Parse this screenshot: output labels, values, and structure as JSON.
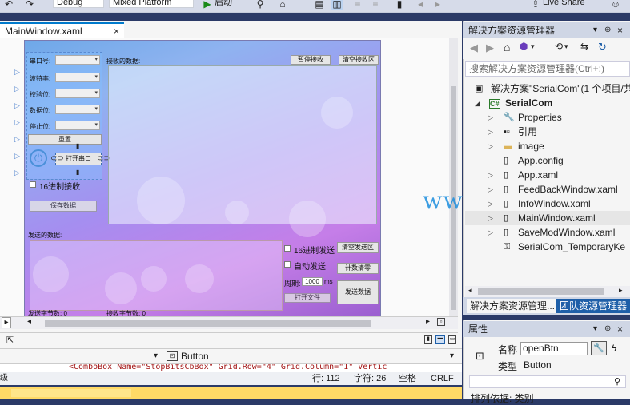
{
  "toolbar": {
    "config_combo": "Debug",
    "platform_combo": "Mixed Platform",
    "start_label": "启动",
    "live_share": "Live Share"
  },
  "editor": {
    "doc_tab": "MainWindow.xaml",
    "doc_tab_close": "×",
    "zoom_badge": "60",
    "col_badge": "1*"
  },
  "app": {
    "labels": [
      "串口号:",
      "波特率:",
      "校验位:",
      "数据位:",
      "停止位:"
    ],
    "reset_btn": "重置",
    "open_port_btn": "打开串口",
    "hex_recv_label": "16进制接收",
    "save_data_btn": "保存数据",
    "recv_data_label": "接收的数据:",
    "pause_recv_btn": "暂停接收",
    "clear_recv_btn": "清空接收区",
    "send_data_label": "发送的数据:",
    "hex_send_label": "16进制发送",
    "clear_send_btn": "清空发送区",
    "auto_send_label": "自动发送",
    "count_clear_btn": "计数清零",
    "period_label": "周期:",
    "period_value": "1000",
    "period_unit": "ms",
    "open_file_btn": "打开文件",
    "send_btn": "发送数据",
    "send_bytes_label": "发送字节数: 0",
    "recv_bytes_label": "接收字节数: 0"
  },
  "nav": {
    "member_combo": "Button"
  },
  "code": {
    "line_text": "<ComboBox Name=\"StopBitsCbBox\"   Grid.Row=\"4\"  Grid.Column=\"1\"  Vertic"
  },
  "status": {
    "line": "行: 112",
    "char": "字符: 26",
    "space": "空格",
    "eol": "CRLF"
  },
  "solution": {
    "title": "解决方案资源管理器",
    "search_placeholder": "搜索解决方案资源管理器(Ctrl+;)",
    "items": [
      {
        "label": "解决方案\"SerialCom\"(1 个项目/共",
        "icon": "solution-icon"
      },
      {
        "label": "SerialCom",
        "icon": "csharp-project-icon"
      },
      {
        "label": "Properties",
        "icon": "wrench-icon"
      },
      {
        "label": "引用",
        "icon": "references-icon"
      },
      {
        "label": "image",
        "icon": "folder-icon"
      },
      {
        "label": "App.config",
        "icon": "config-file-icon"
      },
      {
        "label": "App.xaml",
        "icon": "xaml-file-icon"
      },
      {
        "label": "FeedBackWindow.xaml",
        "icon": "xaml-file-icon"
      },
      {
        "label": "InfoWindow.xaml",
        "icon": "xaml-file-icon"
      },
      {
        "label": "MainWindow.xaml",
        "icon": "xaml-file-icon"
      },
      {
        "label": "SaveModWindow.xaml",
        "icon": "xaml-file-icon"
      },
      {
        "label": "SerialCom_TemporaryKe",
        "icon": "key-file-icon"
      }
    ],
    "tab_solution": "解决方案资源管理...",
    "tab_team": "团队资源管理器"
  },
  "properties": {
    "title": "属性",
    "name_label": "名称",
    "name_value": "openBtn",
    "type_label": "类型",
    "type_value": "Button",
    "sort_label": "排列依据: 类别"
  },
  "watermark": "www.eleok.com"
}
